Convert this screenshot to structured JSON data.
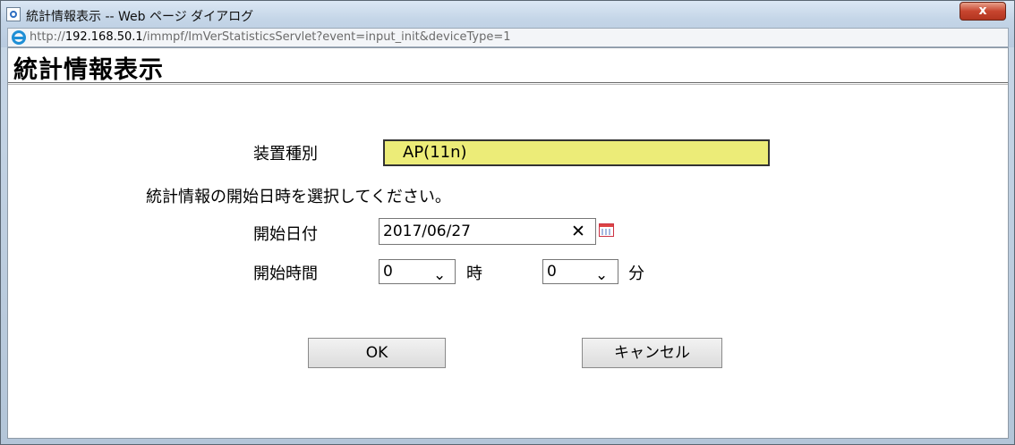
{
  "window": {
    "title": "統計情報表示 -- Web ページ ダイアログ",
    "close_label": "x"
  },
  "address": {
    "prefix": "http://",
    "host": "192.168.50.1",
    "path": "/immpf/ImVerStatisticsServlet?event=input_init&deviceType=1"
  },
  "page": {
    "title": "統計情報表示",
    "device_type_label": "装置種別",
    "device_type_value": "AP(11n)",
    "instruction": "統計情報の開始日時を選択してください。",
    "start_date_label": "開始日付",
    "start_date_value": "2017/06/27",
    "start_time_label": "開始時間",
    "hour_value": "0",
    "hour_unit": "時",
    "minute_value": "0",
    "minute_unit": "分",
    "ok_label": "OK",
    "cancel_label": "キャンセル"
  },
  "icons": {
    "title": "ie-page-icon",
    "address": "ie-logo-icon",
    "calendar": "calendar-icon",
    "clear": "clear-icon",
    "chevron": "chevron-down-icon",
    "cursor": "mouse-cursor-icon"
  },
  "colors": {
    "device_box": "#ecec78",
    "close_button": "#c7452f"
  }
}
